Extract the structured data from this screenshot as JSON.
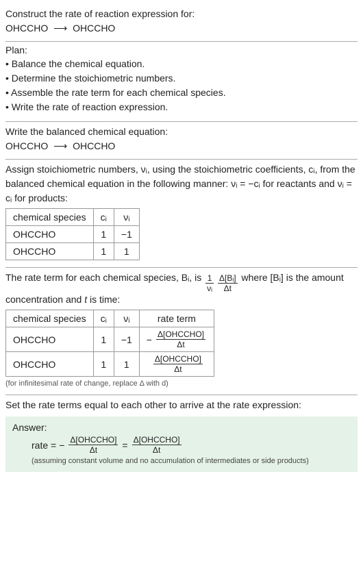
{
  "prompt": {
    "title": "Construct the rate of reaction expression for:",
    "reactant": "OHCCHO",
    "arrow": "⟶",
    "product": "OHCCHO"
  },
  "plan": {
    "heading": "Plan:",
    "items": [
      "• Balance the chemical equation.",
      "• Determine the stoichiometric numbers.",
      "• Assemble the rate term for each chemical species.",
      "• Write the rate of reaction expression."
    ]
  },
  "balanced": {
    "heading": "Write the balanced chemical equation:",
    "reactant": "OHCCHO",
    "arrow": "⟶",
    "product": "OHCCHO"
  },
  "stoich": {
    "text_a": "Assign stoichiometric numbers, ",
    "nu_i": "νᵢ",
    "text_b": ", using the stoichiometric coefficients, ",
    "c_i": "cᵢ",
    "text_c": ", from the balanced chemical equation in the following manner: ",
    "rel_react": "νᵢ = −cᵢ",
    "text_d": " for reactants and ",
    "rel_prod": "νᵢ = cᵢ",
    "text_e": " for products:",
    "table": {
      "headers": {
        "species": "chemical species",
        "ci": "cᵢ",
        "nui": "νᵢ"
      },
      "rows": [
        {
          "species": "OHCCHO",
          "ci": "1",
          "nui": "−1"
        },
        {
          "species": "OHCCHO",
          "ci": "1",
          "nui": "1"
        }
      ]
    }
  },
  "rateterm": {
    "text_a": "The rate term for each chemical species, ",
    "Bi": "Bᵢ",
    "text_b": ", is ",
    "frac1_num": "1",
    "frac1_den": "νᵢ",
    "frac2_num": "Δ[Bᵢ]",
    "frac2_den": "Δt",
    "text_c": " where ",
    "conc": "[Bᵢ]",
    "text_d": " is the amount concentration and ",
    "t": "t",
    "text_e": " is time:",
    "table": {
      "headers": {
        "species": "chemical species",
        "ci": "cᵢ",
        "nui": "νᵢ",
        "rate": "rate term"
      },
      "rows": [
        {
          "species": "OHCCHO",
          "ci": "1",
          "nui": "−1",
          "neg": "−",
          "num": "Δ[OHCCHO]",
          "den": "Δt"
        },
        {
          "species": "OHCCHO",
          "ci": "1",
          "nui": "1",
          "neg": "",
          "num": "Δ[OHCCHO]",
          "den": "Δt"
        }
      ]
    },
    "note": "(for infinitesimal rate of change, replace Δ with d)"
  },
  "final": {
    "heading": "Set the rate terms equal to each other to arrive at the rate expression:"
  },
  "answer": {
    "label": "Answer:",
    "lhs": "rate =",
    "neg": "−",
    "frac_num": "Δ[OHCCHO]",
    "frac_den": "Δt",
    "eq": "=",
    "note": "(assuming constant volume and no accumulation of intermediates or side products)"
  }
}
